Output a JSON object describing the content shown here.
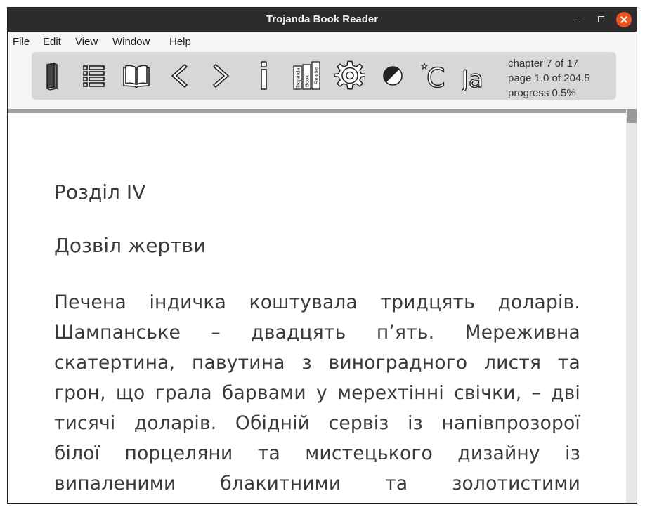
{
  "window": {
    "title": "Trojanda Book Reader"
  },
  "menu": {
    "items": [
      "File",
      "Edit",
      "View",
      "Window",
      "Help"
    ]
  },
  "toolbar": {
    "buttons": [
      {
        "name": "book",
        "icon": "book-icon"
      },
      {
        "name": "contents",
        "icon": "list-icon"
      },
      {
        "name": "open-book",
        "icon": "open-book-icon"
      },
      {
        "name": "previous",
        "icon": "chevron-left-icon"
      },
      {
        "name": "next",
        "icon": "chevron-right-icon"
      },
      {
        "name": "info",
        "icon": "info-icon"
      },
      {
        "name": "library",
        "icon": "library-icon",
        "spines": [
          "Trojanda",
          "Book",
          "Reader"
        ]
      },
      {
        "name": "settings",
        "icon": "gear-icon"
      },
      {
        "name": "contrast",
        "icon": "contrast-icon"
      },
      {
        "name": "night-theme",
        "icon": "night-c-icon",
        "text": "C"
      },
      {
        "name": "font",
        "icon": "font-icon",
        "text": "Ja"
      }
    ],
    "status": {
      "chapter": "chapter 7 of 17",
      "page": "page 1.0 of 204.5",
      "progress": "progress 0.5%"
    }
  },
  "document": {
    "chapter_title": "Розділ IV",
    "section_title": "Дозвіл жертви",
    "lines": [
      "Печена індичка коштувала тридцять доларів.",
      "Шампанське – двадцять п’ять. Мереживна",
      "скатертина, павутина з виноградного листя та",
      "грон, що грала барвами у мерехтінні свічки, – дві",
      "тисячі доларів. Обідній сервіз із напівпрозорої",
      "білої порцеляни та мистецького дизайну із",
      "випаленими блакитними та золотистими"
    ]
  },
  "colors": {
    "titlebar": "#2c2c2c",
    "close_button": "#e95420",
    "toolbar_bg": "#d7d7d7",
    "separator": "#a0a0a0",
    "text": "#3a3a3a"
  }
}
